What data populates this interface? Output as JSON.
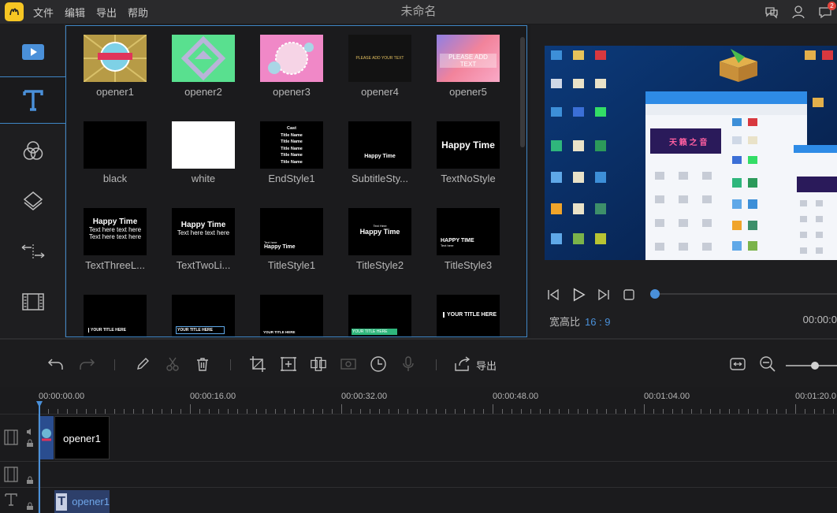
{
  "app": {
    "window_title": "未命名",
    "menu": [
      "文件",
      "编辑",
      "导出",
      "帮助"
    ],
    "notification_count": "2"
  },
  "rail": {
    "items": [
      {
        "icon": "media-icon"
      },
      {
        "icon": "text-icon",
        "active": true
      },
      {
        "icon": "filters-icon"
      },
      {
        "icon": "overlays-icon"
      },
      {
        "icon": "transitions-icon"
      },
      {
        "icon": "film-icon"
      }
    ]
  },
  "library": {
    "items": [
      {
        "label": "opener1"
      },
      {
        "label": "opener2"
      },
      {
        "label": "opener3"
      },
      {
        "label": "opener4",
        "thumb_text": "PLEASE ADD YOUR TEXT"
      },
      {
        "label": "opener5",
        "thumb_text": "PLEASE ADD TEXT"
      },
      {
        "label": "black"
      },
      {
        "label": "white"
      },
      {
        "label": "EndStyle1",
        "thumb_lines": [
          "Cast",
          "Title Name",
          "Title Name",
          "Title Name",
          "Title Name",
          "Title Name"
        ]
      },
      {
        "label": "SubtitleSty...",
        "thumb_text": "Happy Time"
      },
      {
        "label": "TextNoStyle",
        "thumb_text": "Happy Time"
      },
      {
        "label": "TextThreeL...",
        "thumb_lines": [
          "Happy Time",
          "Text here text here",
          "Text here text here"
        ]
      },
      {
        "label": "TextTwoLi...",
        "thumb_lines": [
          "Happy Time",
          "Text here text here"
        ]
      },
      {
        "label": "TitleStyle1",
        "thumb_lines": [
          "Text here",
          "Happy Time"
        ]
      },
      {
        "label": "TitleStyle2",
        "thumb_lines": [
          "Text Here",
          "Happy Time"
        ]
      },
      {
        "label": "TitleStyle3",
        "thumb_lines": [
          "HAPPY TIME",
          "Text here"
        ]
      },
      {
        "label": "",
        "thumb_text": "YOUR TITLE HERE"
      },
      {
        "label": "",
        "thumb_text": "YOUR TITLE HERE"
      },
      {
        "label": "",
        "thumb_text": "YOUR TITLE HERE"
      },
      {
        "label": "",
        "thumb_text": "YOUR TITLE HERE"
      },
      {
        "label": "",
        "thumb_text": "YOUR TITLE HERE"
      }
    ]
  },
  "preview": {
    "aspect_label": "宽高比",
    "aspect_value": "16 : 9",
    "time": "00:00:0",
    "progress": 0
  },
  "toolbar": {
    "export_label": "导出",
    "zoom_level": 0.5
  },
  "timeline": {
    "ruler": [
      "00:00:00.00",
      "00:00:16.00",
      "00:00:32.00",
      "00:00:48.00",
      "00:01:04.00",
      "00:01:20.0"
    ],
    "video_clip_label": "opener1",
    "text_clip_label": "opener1"
  },
  "colors": {
    "accent": "#4a90d9",
    "background": "#1c1c1e",
    "logo": "#f6c623"
  }
}
